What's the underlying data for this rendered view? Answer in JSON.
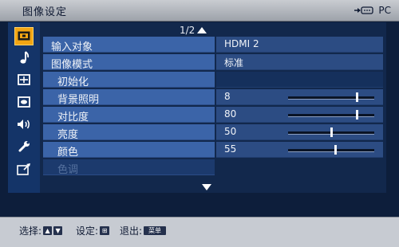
{
  "title": "图像设定",
  "input_indicator": {
    "label": "PC",
    "icon": "pc-input-icon"
  },
  "sidebar": {
    "items": [
      {
        "name": "picture",
        "icon": "picture-icon",
        "active": true
      },
      {
        "name": "sound",
        "icon": "music-note-icon",
        "active": false
      },
      {
        "name": "screen",
        "icon": "screen-icon",
        "active": false
      },
      {
        "name": "display",
        "icon": "display-icon",
        "active": false
      },
      {
        "name": "audio",
        "icon": "speaker-icon",
        "active": false
      },
      {
        "name": "setup",
        "icon": "wrench-icon",
        "active": false
      },
      {
        "name": "input",
        "icon": "input-icon",
        "active": false
      }
    ]
  },
  "page_indicator": "1/2",
  "menu": {
    "rows": [
      {
        "label": "输入对象",
        "value": "HDMI 2"
      },
      {
        "label": "图像模式",
        "value": "标准"
      },
      {
        "label": "初始化",
        "value": ""
      },
      {
        "label": "背景照明",
        "value": "8",
        "slider_fraction": 0.8
      },
      {
        "label": "对比度",
        "value": "80",
        "slider_fraction": 0.8
      },
      {
        "label": "亮度",
        "value": "50",
        "slider_fraction": 0.5
      },
      {
        "label": "颜色",
        "value": "55",
        "slider_fraction": 0.55
      },
      {
        "label": "色调",
        "value": "",
        "disabled": true
      }
    ]
  },
  "statusbar": {
    "select_label": "选择:",
    "select_keys": [
      "▲",
      "▼"
    ],
    "set_label": "设定:",
    "set_key": "⊞",
    "exit_label": "退出:",
    "exit_key": "菜单"
  },
  "colors": {
    "accent_active_tab": "#f2a513",
    "label_cell": "#3b64a8",
    "value_cell": "#2c4c83",
    "panel_bg": "#12284c",
    "titlebar_bg": "#c9ccd1"
  }
}
